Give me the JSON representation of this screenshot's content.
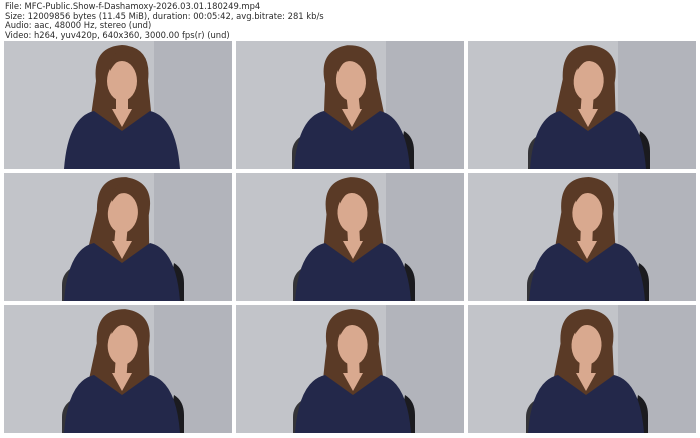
{
  "header": {
    "file_line": "File: MFC-Public.Show-f-Dashamoxy-2026.03.01.180249.mp4",
    "size_line": "Size: 12009856 bytes (11.45 MiB), duration: 00:05:42, avg.bitrate: 281 kb/s",
    "audio_line": "Audio: aac, 48000 Hz, stereo (und)",
    "video_line": "Video: h264, yuv420p, 640x360, 3000.00 fps(r) (und)"
  },
  "thumbnails": [
    {
      "index": 1,
      "subject": "video-frame",
      "chair": false
    },
    {
      "index": 2,
      "subject": "video-frame",
      "chair": true
    },
    {
      "index": 3,
      "subject": "video-frame",
      "chair": true
    },
    {
      "index": 4,
      "subject": "video-frame",
      "chair": true
    },
    {
      "index": 5,
      "subject": "video-frame",
      "chair": true
    },
    {
      "index": 6,
      "subject": "video-frame",
      "chair": true
    },
    {
      "index": 7,
      "subject": "video-frame",
      "chair": true
    },
    {
      "index": 8,
      "subject": "video-frame",
      "chair": true
    },
    {
      "index": 9,
      "subject": "video-frame",
      "chair": true
    }
  ],
  "colors": {
    "wall": "#c2c4c9",
    "shadow": "#a5a8ae",
    "hair": "#5a3a26",
    "skin": "#d9a98f",
    "top": "#23284a",
    "chair": "#1b1b1f"
  }
}
